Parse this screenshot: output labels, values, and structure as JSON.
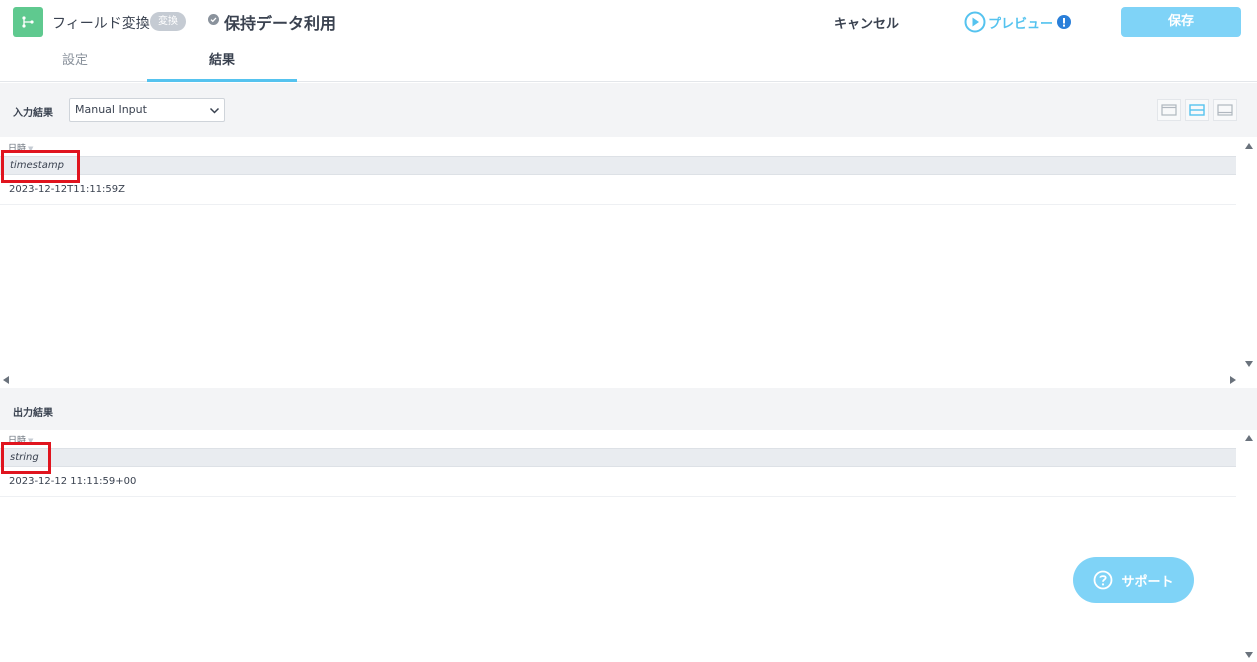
{
  "header": {
    "app_name": "フィールド変換",
    "type_badge": "変換",
    "task_name": "保持データ利用",
    "cancel_label": "キャンセル",
    "preview_label": "プレビュー",
    "save_label": "保存"
  },
  "tabs": [
    {
      "label": "設定",
      "active": false
    },
    {
      "label": "結果",
      "active": true
    }
  ],
  "input": {
    "section_label": "入力結果",
    "select_value": "Manual Input",
    "column_name": "日時",
    "column_type": "timestamp",
    "rows": [
      "2023-12-12T11:11:59Z"
    ]
  },
  "output": {
    "section_label": "出力結果",
    "column_name": "日時",
    "column_type": "string",
    "rows": [
      "2023-12-12 11:11:59+00"
    ]
  },
  "support": {
    "label": "サポート"
  },
  "colors": {
    "accent": "#55c3ef",
    "save_button": "#7fd3f7",
    "app_icon": "#5fc98f",
    "highlight": "#e0141e",
    "warning": "#2a7fd9"
  }
}
